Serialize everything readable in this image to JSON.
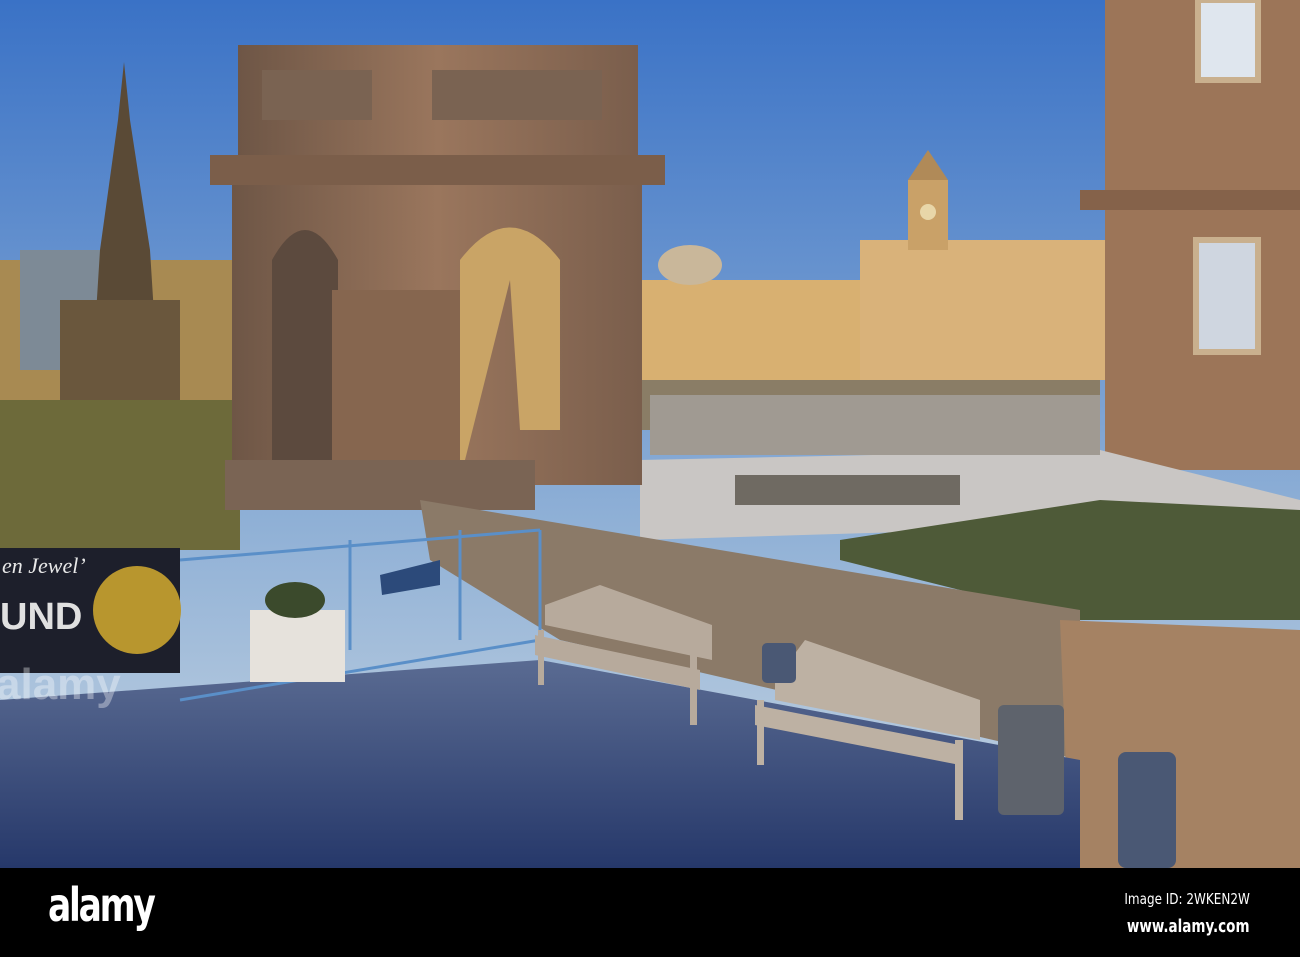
{
  "photo": {
    "banner_line1": "en Jewel’",
    "banner_line2": "UND",
    "watermark": "alamy"
  },
  "footer": {
    "logo": "alamy",
    "image_id": "Image ID: 2WKEN2W",
    "url": "www.alamy.com"
  },
  "colors": {
    "sky_top": "#3f78c9",
    "sky_low": "#a9c3dc",
    "stone": "#8a6a55",
    "sandstone": "#d9b27a",
    "paving": "#3a4c7a"
  }
}
